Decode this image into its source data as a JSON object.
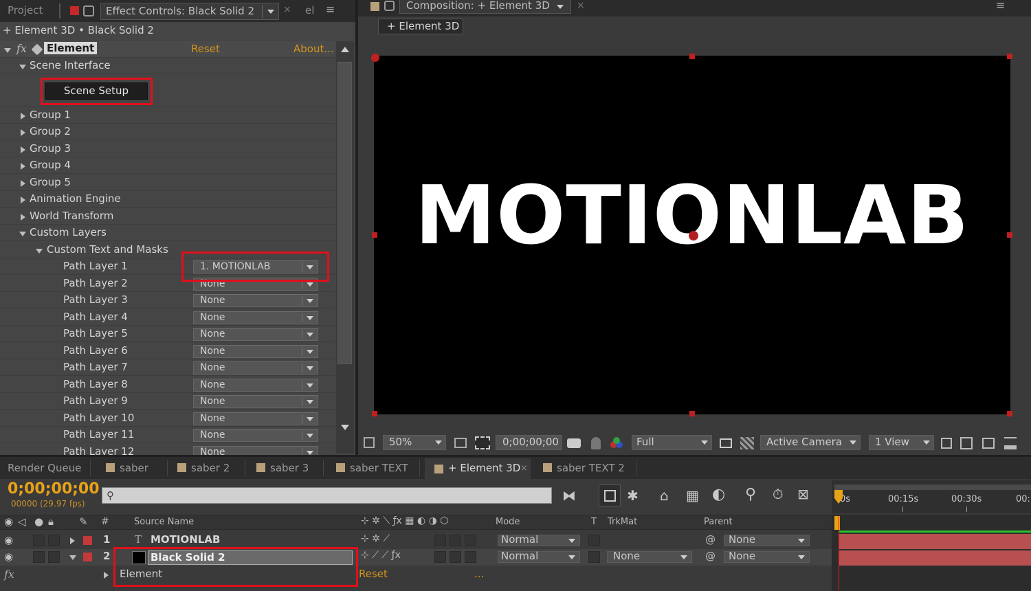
{
  "left_panel": {
    "tabs": {
      "project": "Project",
      "effect_controls": "Effect Controls: Black Solid 2",
      "el": "el"
    },
    "breadcrumb": "+ Element 3D • Black Solid 2",
    "effect": {
      "fx": "fx",
      "name": "Element",
      "reset": "Reset",
      "about": "About..."
    },
    "scene_interface": "Scene Interface",
    "scene_setup_button": "Scene Setup",
    "groups": [
      "Group 1",
      "Group 2",
      "Group 3",
      "Group 4",
      "Group 5",
      "Animation Engine",
      "World Transform"
    ],
    "custom_layers": "Custom Layers",
    "custom_text_and_masks": "Custom Text and Masks",
    "path_layers": [
      {
        "label": "Path Layer 1",
        "value": "1. MOTIONLAB"
      },
      {
        "label": "Path Layer 2",
        "value": "None"
      },
      {
        "label": "Path Layer 3",
        "value": "None"
      },
      {
        "label": "Path Layer 4",
        "value": "None"
      },
      {
        "label": "Path Layer 5",
        "value": "None"
      },
      {
        "label": "Path Layer 6",
        "value": "None"
      },
      {
        "label": "Path Layer 7",
        "value": "None"
      },
      {
        "label": "Path Layer 8",
        "value": "None"
      },
      {
        "label": "Path Layer 9",
        "value": "None"
      },
      {
        "label": "Path Layer 10",
        "value": "None"
      },
      {
        "label": "Path Layer 11",
        "value": "None"
      },
      {
        "label": "Path Layer 12",
        "value": "None"
      }
    ]
  },
  "comp_panel": {
    "tab_title": "Composition: + Element 3D",
    "comp_button": "+ Element 3D",
    "viewer_text": "MOTIONLAB",
    "zoom": "50%",
    "timecode": "0;00;00;00",
    "resolution": "Full",
    "camera": "Active Camera",
    "views": "1 View"
  },
  "timeline": {
    "tabs": [
      "Render Queue",
      "saber",
      "saber 2",
      "saber 3",
      "saber TEXT",
      "+ Element 3D",
      "saber TEXT 2"
    ],
    "active_tab": "+ Element 3D",
    "timecode": "0;00;00;00",
    "frame_info": "00000 (29.97 fps)",
    "search_placeholder": "",
    "columns": {
      "hash": "#",
      "source_name": "Source Name",
      "mode": "Mode",
      "t": "T",
      "trkmat": "TrkMat",
      "parent": "Parent"
    },
    "ruler": [
      "0s",
      "00:15s",
      "00:30s",
      "00:"
    ],
    "layers": [
      {
        "num": "1",
        "name": "MOTIONLAB",
        "mode": "Normal",
        "trkmat": "",
        "parent": "None"
      },
      {
        "num": "2",
        "name": "Black Solid 2",
        "mode": "Normal",
        "trkmat": "None",
        "parent": "None"
      }
    ],
    "effect_row": {
      "fx": "fx",
      "name": "Element",
      "reset": "Reset",
      "dots": "..."
    }
  },
  "colors": {
    "highlight_red": "#e0101a",
    "timecode_yellow": "#e8a317",
    "layer_bar_red": "#b85050",
    "label_red": "#c23a3a",
    "reset_orange": "#d4941c"
  }
}
